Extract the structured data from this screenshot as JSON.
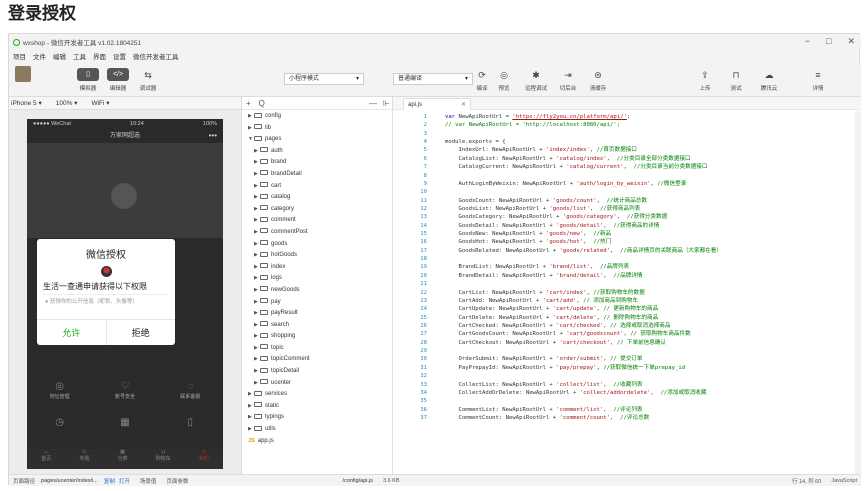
{
  "heading": "登录授权",
  "window": {
    "title": "wxshop - 微信开发者工具 v1.02.1804251",
    "controls": [
      "−",
      "□",
      "✕"
    ]
  },
  "menu": [
    "项目",
    "文件",
    "编辑",
    "工具",
    "界面",
    "设置",
    "微信开发者工具"
  ],
  "toolbar": {
    "simulator": "模拟器",
    "editor": "编辑器",
    "debugger": "调试器",
    "mode_select": "小程序模式",
    "compile_select": "普通编译",
    "compile": "编译",
    "preview": "预览",
    "remote_debug": "远程调试",
    "cut_backend": "切后台",
    "clear_cache": "清缓存",
    "upload": "上传",
    "test": "测试",
    "cloud": "腾讯云",
    "details": "详情"
  },
  "device": {
    "model": "iPhone 5",
    "zoom": "100%",
    "network": "WiFi"
  },
  "phone": {
    "carrier": "●●●●● WeChat",
    "time": "10:24",
    "battery": "100%",
    "nav_title": "万家网超选",
    "grid_row1": [
      "地址管理",
      "账号安全",
      "联系客服"
    ],
    "tabs": [
      "首页",
      "专题",
      "分类",
      "购物车",
      "我的"
    ]
  },
  "dialog": {
    "title": "微信授权",
    "message": "生活一查通申请获得以下权限",
    "permission": "● 获得你的公开信息（昵称、头像等）",
    "allow": "允许",
    "deny": "拒绝"
  },
  "footer": {
    "path_label": "页面路径",
    "path": "pages/ucenter/index/i...",
    "copy": "复制",
    "open": "打开",
    "scene": "场景值",
    "params": "页面参数",
    "file": "/config/api.js",
    "size": "3.6 KB",
    "cursor": "行 14, 列 60",
    "lang": "JavaScript"
  },
  "explorer": {
    "add": "+",
    "search": "Q",
    "collapse": "—",
    "items": [
      {
        "label": "config",
        "arrow": "▶",
        "indent": 0
      },
      {
        "label": "lib",
        "arrow": "▶",
        "indent": 0
      },
      {
        "label": "pages",
        "arrow": "▼",
        "indent": 0
      },
      {
        "label": "auth",
        "arrow": "▶",
        "indent": 1
      },
      {
        "label": "brand",
        "arrow": "▶",
        "indent": 1
      },
      {
        "label": "brandDetail",
        "arrow": "▶",
        "indent": 1
      },
      {
        "label": "cart",
        "arrow": "▶",
        "indent": 1
      },
      {
        "label": "catalog",
        "arrow": "▶",
        "indent": 1
      },
      {
        "label": "category",
        "arrow": "▶",
        "indent": 1
      },
      {
        "label": "comment",
        "arrow": "▶",
        "indent": 1
      },
      {
        "label": "commentPost",
        "arrow": "▶",
        "indent": 1
      },
      {
        "label": "goods",
        "arrow": "▶",
        "indent": 1
      },
      {
        "label": "hotGoods",
        "arrow": "▶",
        "indent": 1
      },
      {
        "label": "index",
        "arrow": "▶",
        "indent": 1
      },
      {
        "label": "logs",
        "arrow": "▶",
        "indent": 1
      },
      {
        "label": "newGoods",
        "arrow": "▶",
        "indent": 1
      },
      {
        "label": "pay",
        "arrow": "▶",
        "indent": 1
      },
      {
        "label": "payResult",
        "arrow": "▶",
        "indent": 1
      },
      {
        "label": "search",
        "arrow": "▶",
        "indent": 1
      },
      {
        "label": "shopping",
        "arrow": "▶",
        "indent": 1
      },
      {
        "label": "topic",
        "arrow": "▶",
        "indent": 1
      },
      {
        "label": "topicComment",
        "arrow": "▶",
        "indent": 1
      },
      {
        "label": "topicDetail",
        "arrow": "▶",
        "indent": 1
      },
      {
        "label": "ucenter",
        "arrow": "▶",
        "indent": 1
      },
      {
        "label": "services",
        "arrow": "▶",
        "indent": 0
      },
      {
        "label": "static",
        "arrow": "▶",
        "indent": 0
      },
      {
        "label": "typings",
        "arrow": "▶",
        "indent": 0
      },
      {
        "label": "utils",
        "arrow": "▶",
        "indent": 0
      },
      {
        "label": "app.js",
        "file": true,
        "indent": 0
      }
    ]
  },
  "editor": {
    "tab": "api.js",
    "lines": [
      {
        "n": "1",
        "segs": [
          [
            "kw",
            "var "
          ],
          [
            "",
            "NewApiRootUrl = "
          ],
          [
            "url",
            "'https://fly2you.cn/platform/api/'"
          ],
          [
            "",
            ";"
          ]
        ]
      },
      {
        "n": "2",
        "segs": [
          [
            "cm",
            "// var NewApiRootUrl = 'http://localhost:8080/api/';"
          ]
        ]
      },
      {
        "n": "3",
        "segs": [
          [
            "",
            ""
          ]
        ]
      },
      {
        "n": "4",
        "segs": [
          [
            "",
            "module.exports = {"
          ]
        ]
      },
      {
        "n": "5",
        "segs": [
          [
            "",
            "    IndexUrl: NewApiRootUrl + "
          ],
          [
            "str",
            "'index/index'"
          ],
          [
            "",
            ", "
          ],
          [
            "cm",
            "//首页数据接口"
          ]
        ]
      },
      {
        "n": "6",
        "segs": [
          [
            "",
            "    CatalogList: NewApiRootUrl + "
          ],
          [
            "str",
            "'catalog/index'"
          ],
          [
            "",
            ",  "
          ],
          [
            "cm",
            "//分类目录全部分类数据接口"
          ]
        ]
      },
      {
        "n": "7",
        "segs": [
          [
            "",
            "    CatalogCurrent: NewApiRootUrl + "
          ],
          [
            "str",
            "'catalog/current'"
          ],
          [
            "",
            ",  "
          ],
          [
            "cm",
            "//分类目录当前分类数据接口"
          ]
        ]
      },
      {
        "n": "8",
        "segs": [
          [
            "",
            ""
          ]
        ]
      },
      {
        "n": "9",
        "segs": [
          [
            "",
            "    AuthLoginByWeixin: NewApiRootUrl + "
          ],
          [
            "str",
            "'auth/login_by_weixin'"
          ],
          [
            "",
            ", "
          ],
          [
            "cm",
            "//微信登录"
          ]
        ]
      },
      {
        "n": "10",
        "segs": [
          [
            "",
            ""
          ]
        ]
      },
      {
        "n": "11",
        "segs": [
          [
            "",
            "    GoodsCount: NewApiRootUrl + "
          ],
          [
            "str",
            "'goods/count'"
          ],
          [
            "",
            ",  "
          ],
          [
            "cm",
            "//统计商品总数"
          ]
        ]
      },
      {
        "n": "12",
        "segs": [
          [
            "",
            "    GoodsList: NewApiRootUrl + "
          ],
          [
            "str",
            "'goods/list'"
          ],
          [
            "",
            ",  "
          ],
          [
            "cm",
            "//获得商品列表"
          ]
        ]
      },
      {
        "n": "13",
        "segs": [
          [
            "",
            "    GoodsCategory: NewApiRootUrl + "
          ],
          [
            "str",
            "'goods/category'"
          ],
          [
            "",
            ",  "
          ],
          [
            "cm",
            "//获得分类数据"
          ]
        ]
      },
      {
        "n": "14",
        "segs": [
          [
            "",
            "    GoodsDetail: NewApiRootUrl + "
          ],
          [
            "str",
            "'goods/detail'"
          ],
          [
            "",
            ",  "
          ],
          [
            "cm",
            "//获得商品的详情"
          ]
        ]
      },
      {
        "n": "15",
        "segs": [
          [
            "",
            "    GoodsNew: NewApiRootUrl + "
          ],
          [
            "str",
            "'goods/new'"
          ],
          [
            "",
            ",  "
          ],
          [
            "cm",
            "//新品"
          ]
        ]
      },
      {
        "n": "16",
        "segs": [
          [
            "",
            "    GoodsHot: NewApiRootUrl + "
          ],
          [
            "str",
            "'goods/hot'"
          ],
          [
            "",
            ",  "
          ],
          [
            "cm",
            "//热门"
          ]
        ]
      },
      {
        "n": "17",
        "segs": [
          [
            "",
            "    GoodsRelated: NewApiRootUrl + "
          ],
          [
            "str",
            "'goods/related'"
          ],
          [
            "",
            ",  "
          ],
          [
            "cm",
            "//商品详情页的关联商品（大家都在看）"
          ]
        ]
      },
      {
        "n": "18",
        "segs": [
          [
            "",
            ""
          ]
        ]
      },
      {
        "n": "19",
        "segs": [
          [
            "",
            "    BrandList: NewApiRootUrl + "
          ],
          [
            "str",
            "'brand/list'"
          ],
          [
            "",
            ",  "
          ],
          [
            "cm",
            "//品牌列表"
          ]
        ]
      },
      {
        "n": "20",
        "segs": [
          [
            "",
            "    BrandDetail: NewApiRootUrl + "
          ],
          [
            "str",
            "'brand/detail'"
          ],
          [
            "",
            ",  "
          ],
          [
            "cm",
            "//品牌详情"
          ]
        ]
      },
      {
        "n": "21",
        "segs": [
          [
            "",
            ""
          ]
        ]
      },
      {
        "n": "22",
        "segs": [
          [
            "",
            "    CartList: NewApiRootUrl + "
          ],
          [
            "str",
            "'cart/index'"
          ],
          [
            "",
            ", "
          ],
          [
            "cm",
            "//获取购物车的数据"
          ]
        ]
      },
      {
        "n": "23",
        "segs": [
          [
            "",
            "    CartAdd: NewApiRootUrl + "
          ],
          [
            "str",
            "'cart/add'"
          ],
          [
            "",
            ", "
          ],
          [
            "cm",
            "// 添加商品到购物车"
          ]
        ]
      },
      {
        "n": "24",
        "segs": [
          [
            "",
            "    CartUpdate: NewApiRootUrl + "
          ],
          [
            "str",
            "'cart/update'"
          ],
          [
            "",
            ", "
          ],
          [
            "cm",
            "// 更新购物车的商品"
          ]
        ]
      },
      {
        "n": "25",
        "segs": [
          [
            "",
            "    CartDelete: NewApiRootUrl + "
          ],
          [
            "str",
            "'cart/delete'"
          ],
          [
            "",
            ", "
          ],
          [
            "cm",
            "// 删除购物车的商品"
          ]
        ]
      },
      {
        "n": "26",
        "segs": [
          [
            "",
            "    CartChecked: NewApiRootUrl + "
          ],
          [
            "str",
            "'cart/checked'"
          ],
          [
            "",
            ", "
          ],
          [
            "cm",
            "// 选择或取消选择商品"
          ]
        ]
      },
      {
        "n": "27",
        "segs": [
          [
            "",
            "    CartGoodsCount: NewApiRootUrl + "
          ],
          [
            "str",
            "'cart/goodscount'"
          ],
          [
            "",
            ", "
          ],
          [
            "cm",
            "// 获取购物车商品件数"
          ]
        ]
      },
      {
        "n": "28",
        "segs": [
          [
            "",
            "    CartCheckout: NewApiRootUrl + "
          ],
          [
            "str",
            "'cart/checkout'"
          ],
          [
            "",
            ", "
          ],
          [
            "cm",
            "// 下单前信息确认"
          ]
        ]
      },
      {
        "n": "29",
        "segs": [
          [
            "",
            ""
          ]
        ]
      },
      {
        "n": "30",
        "segs": [
          [
            "",
            "    OrderSubmit: NewApiRootUrl + "
          ],
          [
            "str",
            "'order/submit'"
          ],
          [
            "",
            ", "
          ],
          [
            "cm",
            "// 提交订单"
          ]
        ]
      },
      {
        "n": "31",
        "segs": [
          [
            "",
            "    PayPrepayId: NewApiRootUrl + "
          ],
          [
            "str",
            "'pay/prepay'"
          ],
          [
            "",
            ", "
          ],
          [
            "cm",
            "//获取微信统一下单prepay_id"
          ]
        ]
      },
      {
        "n": "32",
        "segs": [
          [
            "",
            ""
          ]
        ]
      },
      {
        "n": "33",
        "segs": [
          [
            "",
            "    CollectList: NewApiRootUrl + "
          ],
          [
            "str",
            "'collect/list'"
          ],
          [
            "",
            ",  "
          ],
          [
            "cm",
            "//收藏列表"
          ]
        ]
      },
      {
        "n": "34",
        "segs": [
          [
            "",
            "    CollectAddOrDelete: NewApiRootUrl + "
          ],
          [
            "str",
            "'collect/addordelete'"
          ],
          [
            "",
            ",  "
          ],
          [
            "cm",
            "//添加或取消收藏"
          ]
        ]
      },
      {
        "n": "35",
        "segs": [
          [
            "",
            ""
          ]
        ]
      },
      {
        "n": "36",
        "segs": [
          [
            "",
            "    CommentList: NewApiRootUrl + "
          ],
          [
            "str",
            "'comment/list'"
          ],
          [
            "",
            ",  "
          ],
          [
            "cm",
            "//评论列表"
          ]
        ]
      },
      {
        "n": "37",
        "segs": [
          [
            "",
            "    CommentCount: NewApiRootUrl + "
          ],
          [
            "str",
            "'comment/count'"
          ],
          [
            "",
            ",  "
          ],
          [
            "cm",
            "//评论总数"
          ]
        ]
      }
    ]
  }
}
